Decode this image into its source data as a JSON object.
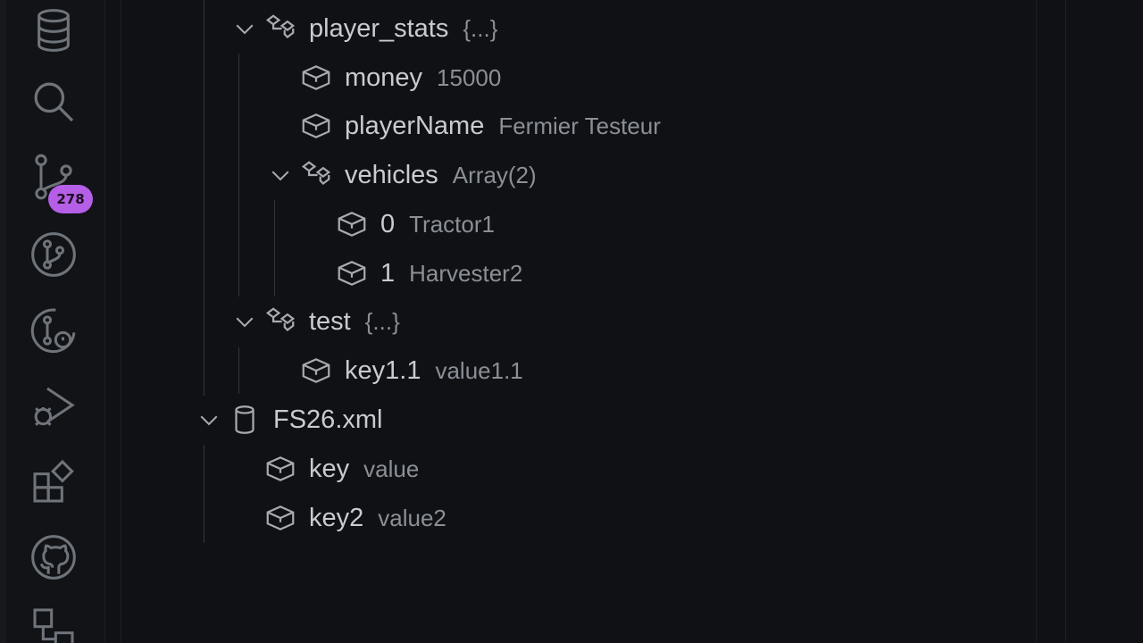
{
  "activity_bar": {
    "icons": [
      "database-icon",
      "search-icon",
      "source-control-icon",
      "git-graph-icon",
      "git-lens-icon",
      "run-debug-icon",
      "extensions-icon",
      "github-icon",
      "remote-explorer-icon"
    ],
    "source_control_badge": "278",
    "badge_color": "#b55ee6"
  },
  "tree": {
    "player_stats": {
      "label": "player_stats",
      "description": "{...}"
    },
    "money": {
      "label": "money",
      "description": "15000"
    },
    "playerName": {
      "label": "playerName",
      "description": "Fermier Testeur"
    },
    "vehicles": {
      "label": "vehicles",
      "description": "Array(2)"
    },
    "vehicle0": {
      "label": "0",
      "description": "Tractor1"
    },
    "vehicle1": {
      "label": "1",
      "description": "Harvester2"
    },
    "test": {
      "label": "test",
      "description": "{...}"
    },
    "key11": {
      "label": "key1.1",
      "description": "value1.1"
    },
    "fs26": {
      "label": "FS26.xml",
      "description": ""
    },
    "key": {
      "label": "key",
      "description": "value"
    },
    "key2": {
      "label": "key2",
      "description": "value2"
    }
  }
}
